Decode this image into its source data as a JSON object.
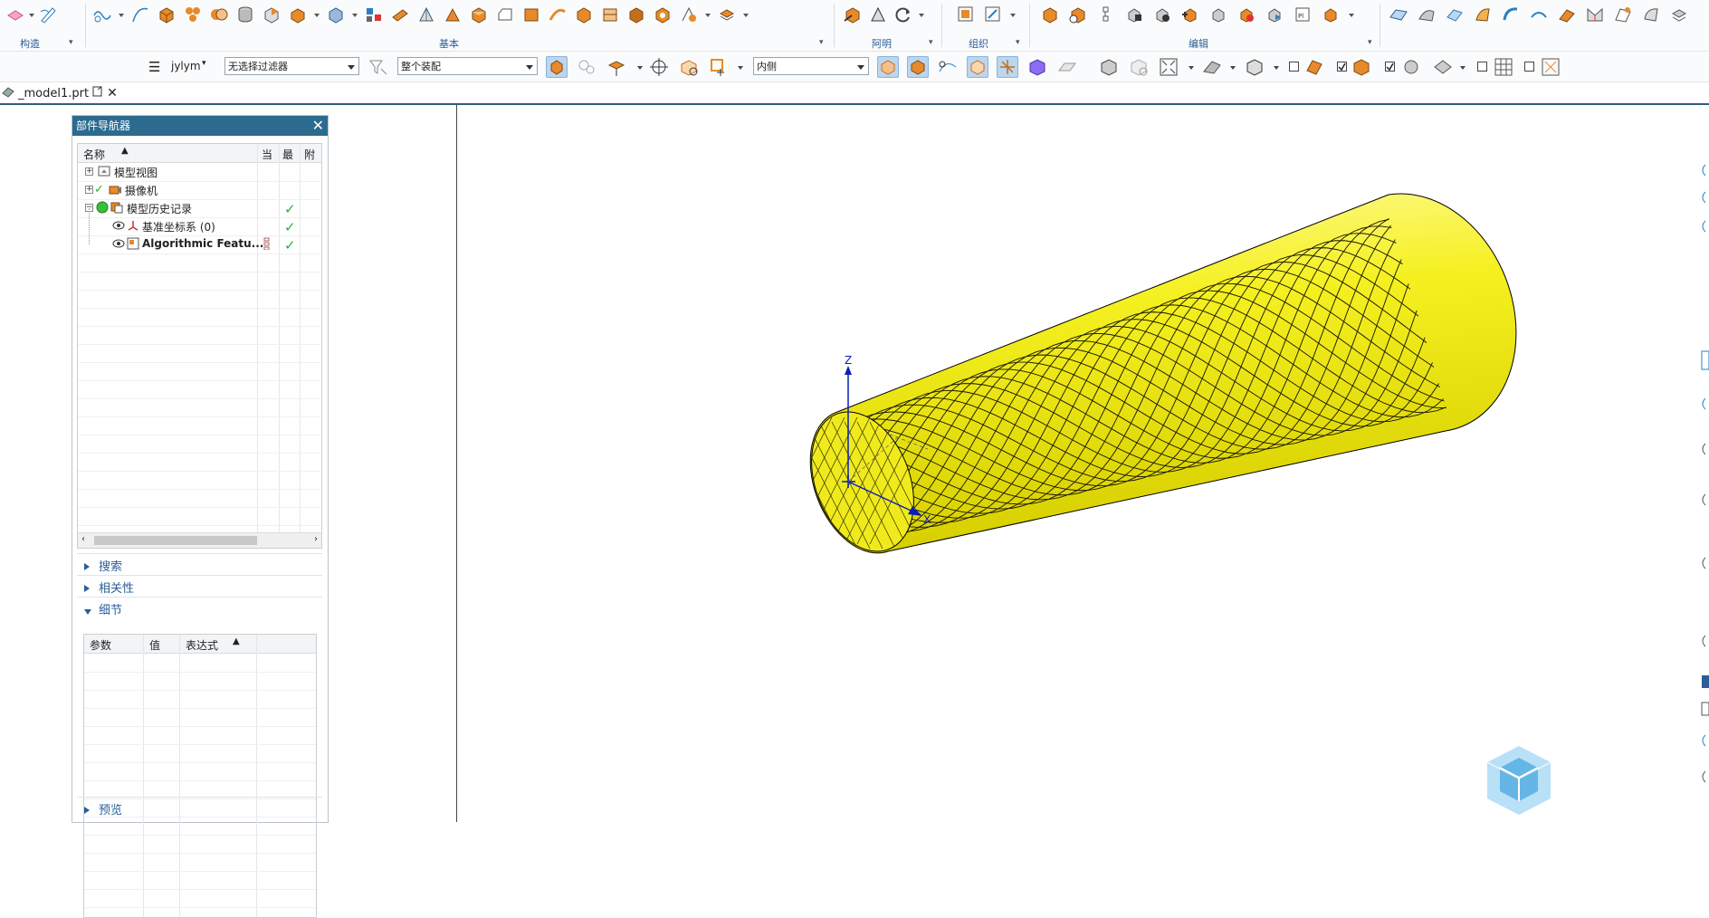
{
  "ribbon": {
    "groups": [
      {
        "label": "构造"
      },
      {
        "label": "基本"
      },
      {
        "label": "阿明"
      },
      {
        "label": "组织"
      },
      {
        "label": "编辑"
      }
    ]
  },
  "toolbar2": {
    "user_menu": "jylym",
    "filter_select": "无选择过滤器",
    "scope_select": "整个装配",
    "side_select": "内侧"
  },
  "document_tab": {
    "name": "_model1.prt"
  },
  "navigator": {
    "title": "部件导航器",
    "columns": {
      "name": "名称",
      "current": "当",
      "latest": "最",
      "attached": "附"
    },
    "nodes": [
      {
        "label": "模型视图"
      },
      {
        "label": "摄像机"
      },
      {
        "label": "模型历史记录"
      },
      {
        "label": "基准坐标系 (0)"
      },
      {
        "label": "Algorithmic Featu..."
      }
    ],
    "sections": {
      "search": "搜索",
      "dependencies": "相关性",
      "details": "细节",
      "preview": "预览"
    },
    "details_columns": {
      "parameter": "参数",
      "value": "值",
      "expression": "表达式"
    }
  },
  "viewport": {
    "axis_z": "Z",
    "axis_x": "X",
    "model_color": "#f5f020"
  },
  "colors": {
    "accent": "#2a5f98",
    "panel_title": "#2c6b8f",
    "check": "#2cae3a"
  }
}
